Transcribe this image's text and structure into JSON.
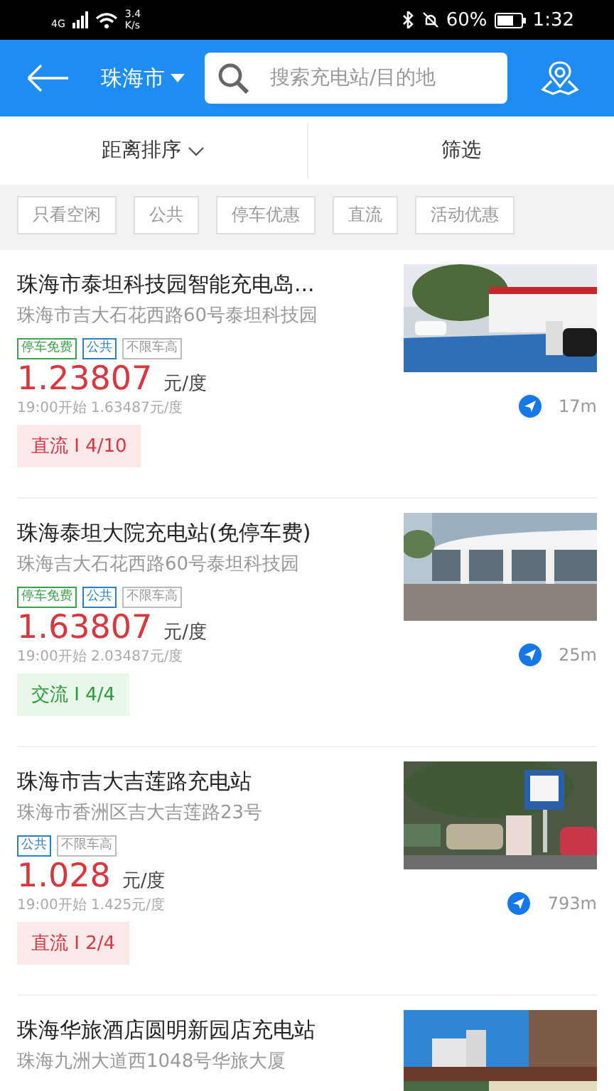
{
  "status_bar": {
    "network": "4G",
    "speed_value": "3.4",
    "speed_unit": "K/s",
    "battery": "60%",
    "time": "1:32"
  },
  "header": {
    "city": "珠海市",
    "search": {
      "placeholder": "搜索充电站/目的地"
    }
  },
  "sort_bar": {
    "sort": "距离排序",
    "filter": "筛选"
  },
  "filter_chips": [
    {
      "label": "只看空闲",
      "selected": false
    },
    {
      "label": "公共",
      "selected": false
    },
    {
      "label": "停车优惠",
      "selected": false
    },
    {
      "label": "直流",
      "selected": false
    },
    {
      "label": "活动优惠",
      "selected": false
    }
  ],
  "stations": [
    {
      "name": "珠海市泰坦科技园智能充电岛...",
      "address": "珠海市吉大石花西路60号泰坦科技园",
      "tags": [
        {
          "kind": "parking",
          "label": "停车免费"
        },
        {
          "kind": "public",
          "label": "公共"
        },
        {
          "kind": "height",
          "label": "不限车高"
        }
      ],
      "price": "1.23807",
      "unit": "元/度",
      "later_price": "19:00开始 1.63487元/度",
      "distance": "17m",
      "charger": {
        "kind": "dc",
        "label": "直流 I 4/10"
      },
      "photo": {
        "kind": "picture"
      }
    },
    {
      "name": "珠海泰坦大院充电站(免停车费)",
      "address": "珠海吉大石花西路60号泰坦科技园",
      "tags": [
        {
          "kind": "parking",
          "label": "停车免费"
        },
        {
          "kind": "public",
          "label": "公共"
        },
        {
          "kind": "height",
          "label": "不限车高"
        }
      ],
      "price": "1.63807",
      "unit": "元/度",
      "later_price": "19:00开始 2.03487元/度",
      "distance": "25m",
      "charger": {
        "kind": "ac",
        "label": "交流 I 4/4"
      },
      "photo": {
        "kind": "picture"
      }
    },
    {
      "name": "珠海市吉大吉莲路充电站",
      "address": "珠海市香洲区吉大吉莲路23号",
      "tags": [
        {
          "kind": "public",
          "label": "公共"
        },
        {
          "kind": "height",
          "label": "不限车高"
        }
      ],
      "price": "1.028",
      "unit": "元/度",
      "later_price": "19:00开始 1.425元/度",
      "distance": "793m",
      "charger": {
        "kind": "dc",
        "label": "直流 I 2/4"
      },
      "photo": {
        "kind": "picture"
      }
    },
    {
      "name": "珠海华旅酒店圆明新园店充电站",
      "address": "珠海九洲大道西1048号华旅大厦",
      "photo": {
        "kind": "picture"
      }
    }
  ]
}
